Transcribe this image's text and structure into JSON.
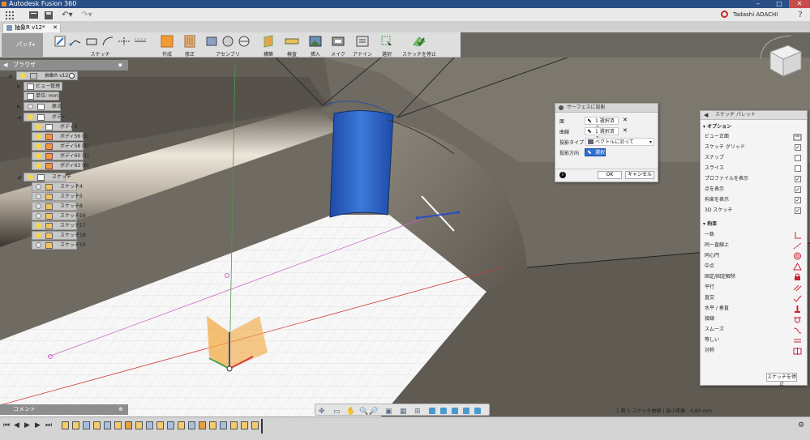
{
  "app": {
    "title": "Autodesk Fusion 360",
    "user": "Tadashi ADACHI"
  },
  "tab": {
    "label": "抽象R v12*"
  },
  "toolbar": {
    "workspace": "パッチ",
    "groups": [
      {
        "id": "sketch",
        "label": "スケッチ"
      },
      {
        "id": "create",
        "label": "作成"
      },
      {
        "id": "modify",
        "label": "修正"
      },
      {
        "id": "assemble",
        "label": "アセンブリ"
      },
      {
        "id": "construct",
        "label": "構築"
      },
      {
        "id": "inspect",
        "label": "検査"
      },
      {
        "id": "insert",
        "label": "挿入"
      },
      {
        "id": "make",
        "label": "メイク"
      },
      {
        "id": "addins",
        "label": "アドイン"
      },
      {
        "id": "select",
        "label": "選択"
      },
      {
        "id": "stop",
        "label": "スケッチを停止"
      }
    ]
  },
  "browser": {
    "title": "ブラウザ",
    "nodes": [
      {
        "label": "抽象R v12",
        "level": 0
      },
      {
        "label": "ビュー管理",
        "level": 1
      },
      {
        "label": "単位: mm",
        "level": 1
      },
      {
        "label": "原点",
        "level": 1
      },
      {
        "label": "ボディ",
        "level": 1
      },
      {
        "label": "ボディ2",
        "level": 2
      },
      {
        "label": "ボディ56 (1)",
        "level": 2
      },
      {
        "label": "ボディ58 (1)",
        "level": 2
      },
      {
        "label": "ボディ60 (1)",
        "level": 2
      },
      {
        "label": "ボディ63 (6)",
        "level": 2
      },
      {
        "label": "スケッチ",
        "level": 1
      },
      {
        "label": "スケッチ4",
        "level": 2
      },
      {
        "label": "スケッチ5",
        "level": 2
      },
      {
        "label": "スケッチ8",
        "level": 2
      },
      {
        "label": "スケッチ16",
        "level": 2
      },
      {
        "label": "スケッチ17",
        "level": 2
      },
      {
        "label": "スケッチ18",
        "level": 2
      },
      {
        "label": "スケッチ19",
        "level": 2
      }
    ]
  },
  "project_dialog": {
    "title": "サーフェスに投影",
    "face_label": "面",
    "face_value": "1 選択済み",
    "curve_label": "曲線",
    "curve_value": "1 選択済み",
    "type_label": "投影タイプ",
    "type_value": "ベクトルに沿って",
    "dir_label": "投影方向",
    "dir_value": "選択",
    "ok": "OK",
    "cancel": "キャンセル"
  },
  "palette": {
    "title": "スケッチ パレット",
    "options_title": "オプション",
    "options": [
      {
        "label": "ビュー正面",
        "icon": "look-at-icon"
      },
      {
        "label": "スケッチ グリッド",
        "checked": true
      },
      {
        "label": "スナップ",
        "checked": false
      },
      {
        "label": "スライス",
        "checked": false
      },
      {
        "label": "プロファイルを表示",
        "checked": true
      },
      {
        "label": "点を表示",
        "checked": true
      },
      {
        "label": "拘束を表示",
        "checked": true
      },
      {
        "label": "3D スケッチ",
        "checked": true
      }
    ],
    "constraints_title": "拘束",
    "constraints": [
      {
        "label": "一致",
        "icon": "coincident-icon"
      },
      {
        "label": "同一直線上",
        "icon": "collinear-icon"
      },
      {
        "label": "同心円",
        "icon": "concentric-icon"
      },
      {
        "label": "中点",
        "icon": "midpoint-icon"
      },
      {
        "label": "固定/固定解除",
        "icon": "fix-icon"
      },
      {
        "label": "平行",
        "icon": "parallel-icon"
      },
      {
        "label": "直交",
        "icon": "perpendicular-icon"
      },
      {
        "label": "水平 / 垂直",
        "icon": "horizontal-vertical-icon"
      },
      {
        "label": "接線",
        "icon": "tangent-icon"
      },
      {
        "label": "スムーズ",
        "icon": "smooth-icon"
      },
      {
        "label": "等しい",
        "icon": "equal-icon"
      },
      {
        "label": "対称",
        "icon": "symmetry-icon"
      }
    ],
    "stop_label": "スケッチを停止"
  },
  "comments": {
    "title": "コメント"
  },
  "status": {
    "text": "1 面 1 スケッチ曲線 | 最小距離 : 4.80 mm"
  },
  "colors": {
    "titlebar": "#2a4f86",
    "select_blue": "#2f6fd0",
    "accent_orange": "#f4a63a"
  }
}
